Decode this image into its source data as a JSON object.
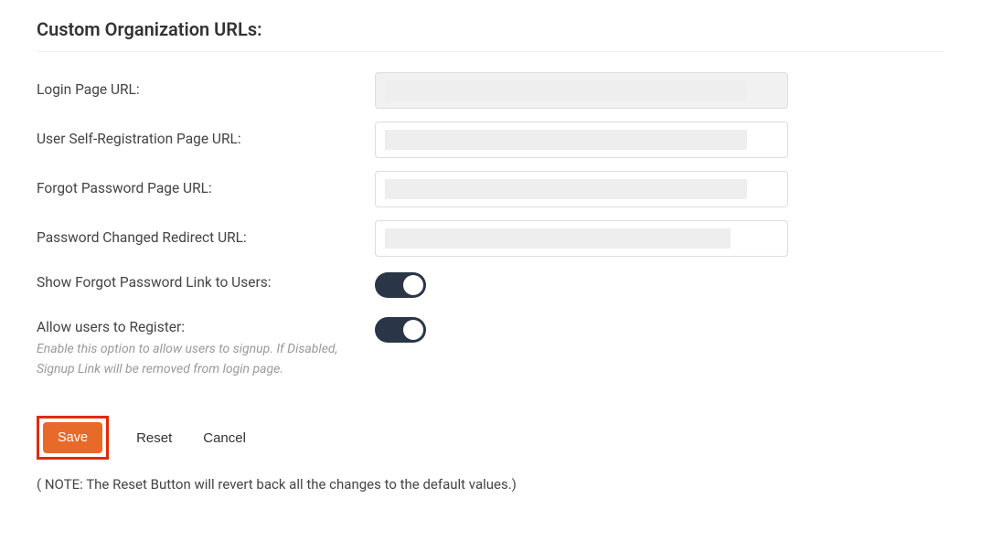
{
  "section_title": "Custom Organization URLs:",
  "fields": {
    "login_url": {
      "label": "Login Page URL:",
      "value": "",
      "disabled": true
    },
    "self_reg_url": {
      "label": "User Self-Registration Page URL:",
      "value": ""
    },
    "forgot_pw_url": {
      "label": "Forgot Password Page URL:",
      "value": ""
    },
    "pw_changed_redirect_url": {
      "label": "Password Changed Redirect URL:",
      "value": ""
    },
    "show_forgot_link": {
      "label": "Show Forgot Password Link to Users:",
      "value": true
    },
    "allow_register": {
      "label": "Allow users to Register:",
      "helper": "Enable this option to allow users to signup. If Disabled, Signup Link will be removed from login page.",
      "value": true
    }
  },
  "buttons": {
    "save": "Save",
    "reset": "Reset",
    "cancel": "Cancel"
  },
  "note": "( NOTE: The Reset Button will revert back all the changes to the default values.)"
}
